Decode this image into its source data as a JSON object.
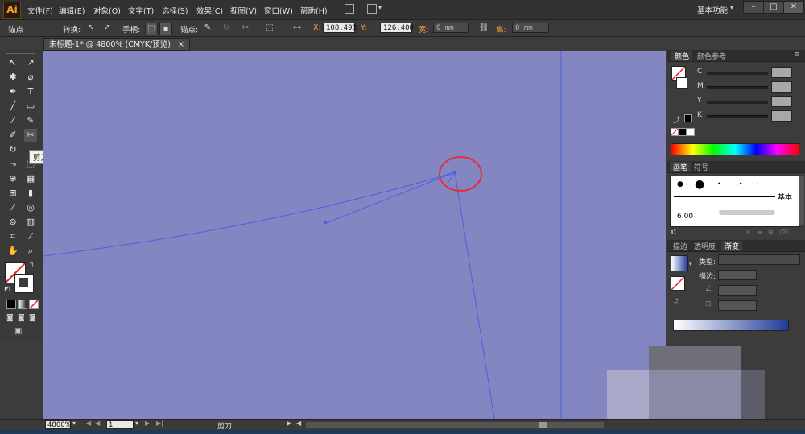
{
  "app": {
    "logo": "Ai",
    "workspace": "基本功能"
  },
  "menu": [
    "文件(F)",
    "编辑(E)",
    "对象(O)",
    "文字(T)",
    "选择(S)",
    "效果(C)",
    "视图(V)",
    "窗口(W)",
    "帮助(H)"
  ],
  "window_buttons": [
    "–",
    "□",
    "✕"
  ],
  "control": {
    "selection_label": "锚点",
    "convert_label": "转换:",
    "handles_label": "手柄:",
    "anchor_label": "锚点:",
    "x_label": "X:",
    "x_value": "108.498",
    "y_label": "Y:",
    "y_value": "126.408",
    "w_label": "宽:",
    "w_value": "0 mm",
    "h_label": "高:",
    "h_value": "0 mm"
  },
  "document": {
    "tab_title": "未标题-1* @ 4800% (CMYK/预览)",
    "close": "×"
  },
  "tooltip": "剪刀工具 (C)",
  "color_panel": {
    "tabs": [
      "颜色",
      "颜色参考"
    ],
    "channels": [
      "C",
      "M",
      "Y",
      "K"
    ]
  },
  "brush_panel": {
    "tabs": [
      "画笔",
      "符号"
    ],
    "basic_label": "基本",
    "size_label": "6.00"
  },
  "gradient_panel": {
    "tabs": [
      "描边",
      "透明度",
      "渐变"
    ],
    "type_label": "类型:",
    "stroke_label": "描边:"
  },
  "status": {
    "zoom": "4800%",
    "page": "1",
    "tool_name": "剪刀"
  },
  "colors": {
    "canvas": "#8486c2",
    "path": "#4a5ee8",
    "highlight_circle": "#e0303a",
    "logo": "#f7a235"
  }
}
